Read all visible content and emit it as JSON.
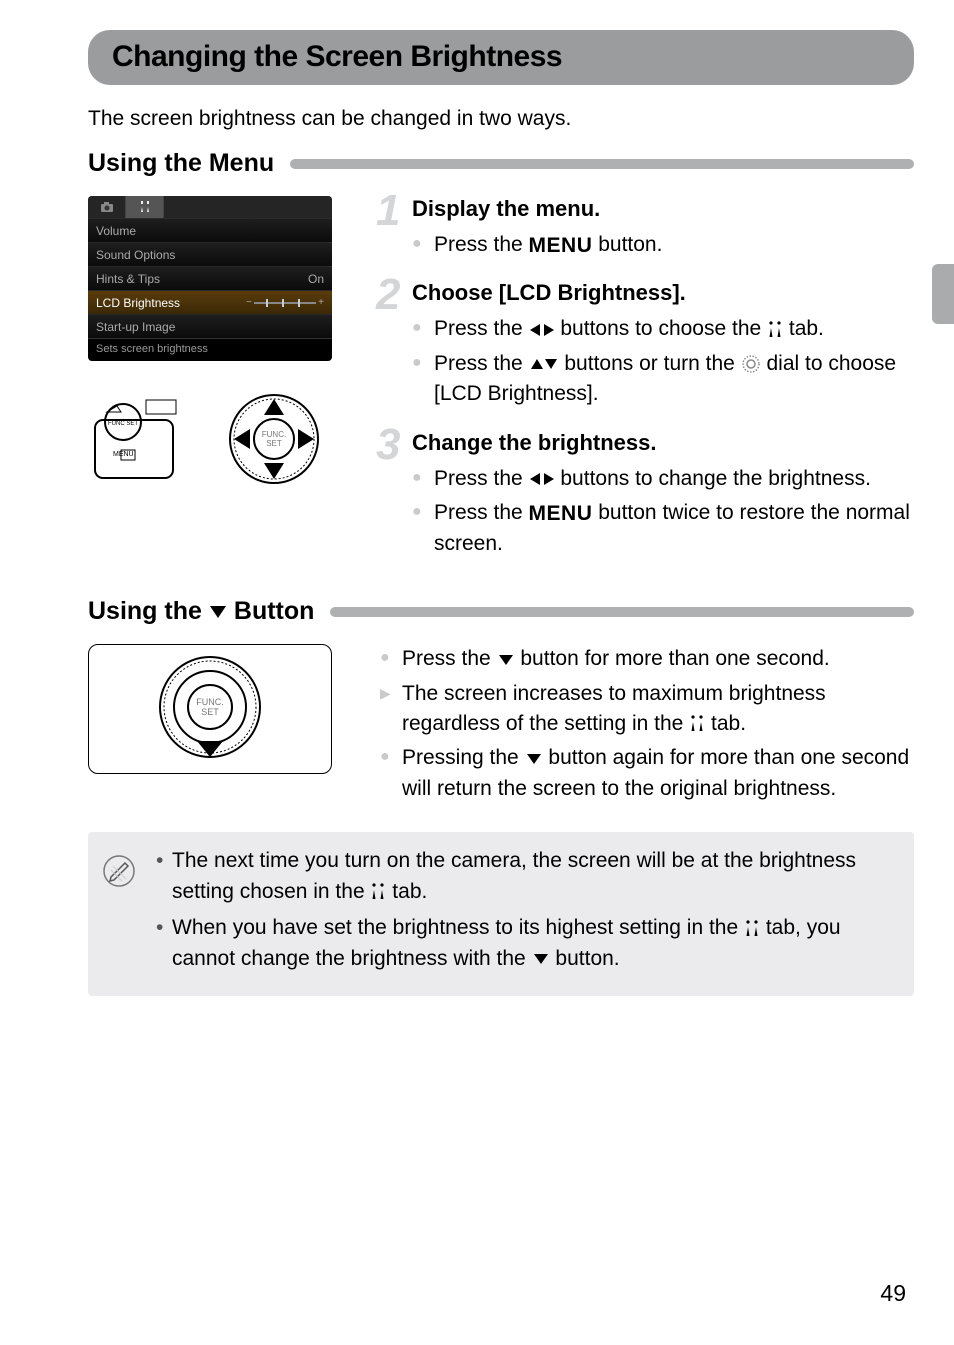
{
  "title": "Changing the Screen Brightness",
  "intro": "The screen brightness can be changed in two ways.",
  "section1_title": "Using the Menu",
  "menu_shot": {
    "rows": [
      {
        "label": "Volume",
        "value": ""
      },
      {
        "label": "Sound Options",
        "value": ""
      },
      {
        "label": "Hints & Tips",
        "value": "On"
      },
      {
        "label": "LCD Brightness",
        "value": "",
        "selected": true,
        "slider": true
      },
      {
        "label": "Start-up Image",
        "value": ""
      }
    ],
    "footer": "Sets screen brightness"
  },
  "steps": [
    {
      "num": "1",
      "title": "Display the menu.",
      "bullets": [
        {
          "type": "dot",
          "segments": [
            "Press the ",
            {
              "icon": "menu"
            },
            " button."
          ]
        }
      ]
    },
    {
      "num": "2",
      "title": "Choose [LCD Brightness].",
      "bullets": [
        {
          "type": "dot",
          "segments": [
            "Press the ",
            {
              "icon": "lr"
            },
            " buttons to choose the ",
            {
              "icon": "tools"
            },
            " tab."
          ]
        },
        {
          "type": "dot",
          "segments": [
            "Press the ",
            {
              "icon": "ud"
            },
            " buttons or turn the ",
            {
              "icon": "dial"
            },
            " dial to choose [LCD Brightness]."
          ]
        }
      ]
    },
    {
      "num": "3",
      "title": "Change the brightness.",
      "bullets": [
        {
          "type": "dot",
          "segments": [
            "Press the ",
            {
              "icon": "lr"
            },
            " buttons to change the brightness."
          ]
        },
        {
          "type": "dot",
          "segments": [
            "Press the ",
            {
              "icon": "menu"
            },
            " button twice to restore the normal screen."
          ]
        }
      ]
    }
  ],
  "section2_title_pre": "Using the ",
  "section2_title_post": " Button",
  "section2_bullets": [
    {
      "type": "dot",
      "segments": [
        "Press the ",
        {
          "icon": "down"
        },
        " button for more than one second."
      ]
    },
    {
      "type": "arrow",
      "segments": [
        "The screen increases to maximum brightness regardless of the setting in the ",
        {
          "icon": "tools"
        },
        " tab."
      ]
    },
    {
      "type": "dot",
      "segments": [
        "Pressing the ",
        {
          "icon": "down"
        },
        " button again for more than one second will return the screen to the original brightness."
      ]
    }
  ],
  "notes": [
    {
      "segments": [
        "The next time you turn on the camera, the screen will be at the brightness setting chosen in the ",
        {
          "icon": "tools"
        },
        " tab."
      ]
    },
    {
      "segments": [
        "When you have set the brightness to its highest setting in the ",
        {
          "icon": "tools"
        },
        " tab, you cannot change the brightness with the ",
        {
          "icon": "down"
        },
        " button."
      ]
    }
  ],
  "page_number": "49"
}
